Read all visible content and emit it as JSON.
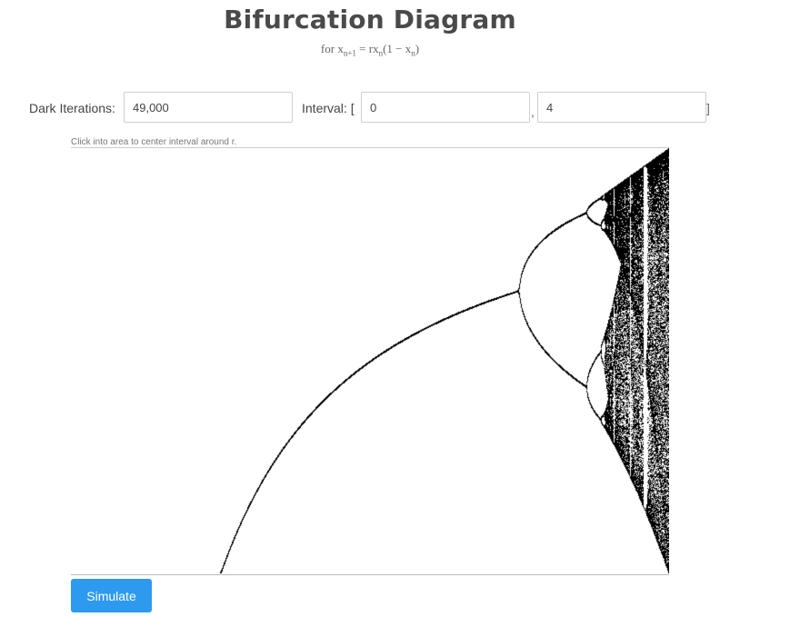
{
  "header": {
    "title": "Bifurcation Diagram",
    "formula_prefix": "for x",
    "formula_sub1": "n+1",
    "formula_mid": " =  rx",
    "formula_sub2": "n",
    "formula_paren": "(1 − x",
    "formula_sub3": "n",
    "formula_close": ")"
  },
  "controls": {
    "iterations_label": "Dark Iterations:",
    "iterations_value": "49,000",
    "interval_label": "Interval: [",
    "interval_min": "0",
    "separator": ",",
    "interval_max": "4",
    "interval_close": "]"
  },
  "plot": {
    "hint": "Click into area to center interval around r.",
    "r_min": 0,
    "r_max": 4,
    "x_min": 0,
    "x_max": 1,
    "point_color": "#000000"
  },
  "actions": {
    "simulate_label": "Simulate"
  },
  "colors": {
    "accent": "#2d9af0",
    "title": "#4a4a4a"
  }
}
